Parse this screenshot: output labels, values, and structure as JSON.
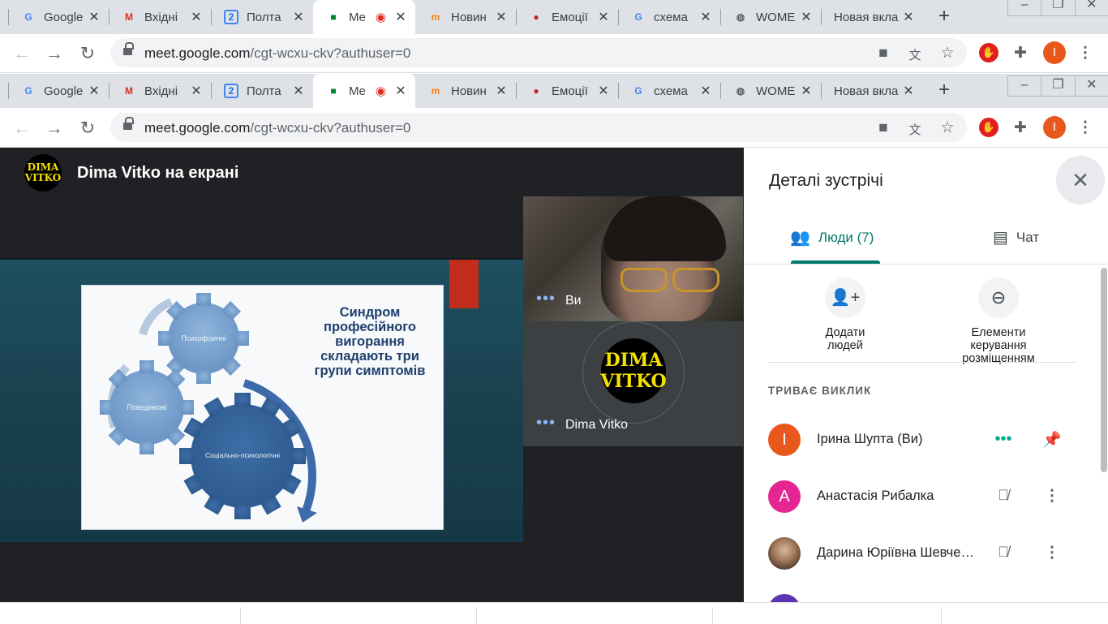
{
  "browser": {
    "tabs": [
      {
        "icon": "google-icon",
        "title": "Google"
      },
      {
        "icon": "gmail-icon",
        "title": "Вхідні"
      },
      {
        "icon": "calendar-icon",
        "title": "Полта"
      },
      {
        "icon": "meet-icon",
        "title": "Me"
      },
      {
        "icon": "moodle-icon",
        "title": "Новин"
      },
      {
        "icon": "record-icon",
        "title": "Емоції"
      },
      {
        "icon": "google-icon",
        "title": "схема"
      },
      {
        "icon": "globe-icon",
        "title": "WOME"
      },
      {
        "icon": "none",
        "title": "Новая вкла"
      }
    ],
    "url_host": "meet.google.com",
    "url_path": "/cgt-wcxu-ckv?authuser=0",
    "profile_initial": "I"
  },
  "meet": {
    "presenter_logo": {
      "line1": "DIMA",
      "line2": "VITKO"
    },
    "presenting_title": "Dima Vitko на екрані",
    "slide": {
      "title": "Синдром професійного вигорання складають три групи симптомів",
      "gear_labels": [
        "Психофізичні",
        "Поведінкові",
        "Соціально-психологічні"
      ]
    },
    "tiles": [
      {
        "name": "Ви"
      },
      {
        "name": "Dima Vitko",
        "logo_line1": "DIMA",
        "logo_line2": "VITKO"
      }
    ]
  },
  "panel": {
    "title": "Деталі зустрічі",
    "tab_people": "Люди (7)",
    "tab_chat": "Чат",
    "add_people": "Додати людей",
    "layout_controls": "Елементи керування розміщенням",
    "section": "ТРИВАЄ ВИКЛИК",
    "people": [
      {
        "initial": "I",
        "color": "#e8581c",
        "name": "Ірина Шупта (Ви)"
      },
      {
        "initial": "A",
        "color": "#e52592",
        "name": "Анастасія Рибалка"
      },
      {
        "initial": "",
        "color": "#8a6a4c",
        "name": "Дарина Юріївна Шевченко"
      },
      {
        "initial": "",
        "color": "#5e35b1",
        "name": ""
      }
    ]
  }
}
